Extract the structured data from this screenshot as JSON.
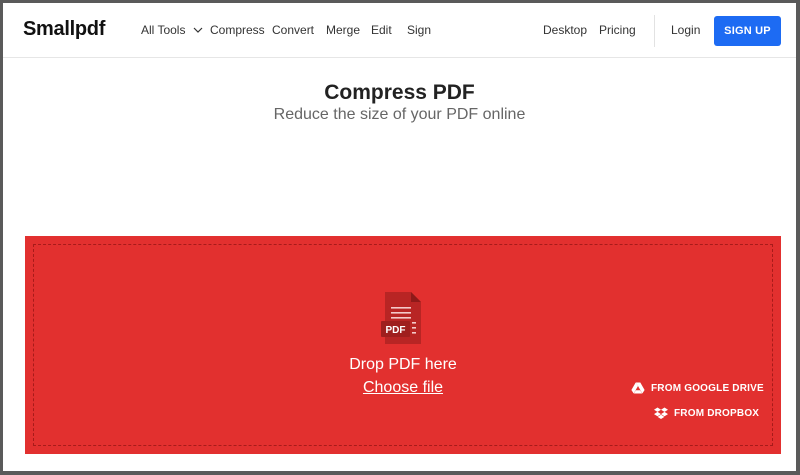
{
  "header": {
    "logo": "Smallpdf",
    "nav": [
      "All Tools",
      "Compress",
      "Convert",
      "Merge",
      "Edit",
      "Sign"
    ],
    "desktop": "Desktop",
    "pricing": "Pricing",
    "login": "Login",
    "signup": "SIGN UP"
  },
  "hero": {
    "title": "Compress PDF",
    "subtitle": "Reduce the size of your PDF online"
  },
  "dropzone": {
    "icon_label": "PDF",
    "drop_text": "Drop PDF here",
    "choose_file": "Choose file",
    "google_drive": "FROM GOOGLE DRIVE",
    "dropbox": "FROM DROPBOX"
  },
  "colors": {
    "accent": "#1d6bf3",
    "dropzone": "#e2302f"
  }
}
